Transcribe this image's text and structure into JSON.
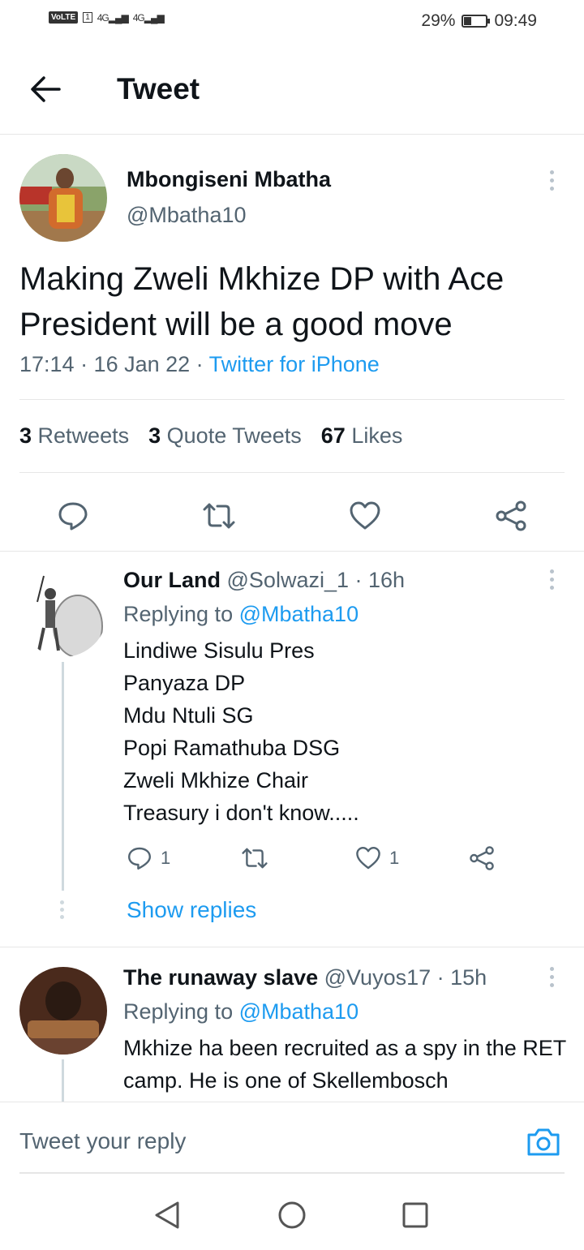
{
  "statusbar": {
    "volte": "VoLTE",
    "sim": "1",
    "net1": "4G",
    "net2": "4G",
    "battery_text": "29%",
    "battery_level": 0.29,
    "time": "09:49"
  },
  "header": {
    "title": "Tweet"
  },
  "tweet": {
    "author_name": "Mbongiseni Mbatha",
    "author_handle": "@Mbatha10",
    "text": "Making Zweli Mkhize DP with Ace President will be a good move",
    "time": "17:14 · 16 Jan 22 · ",
    "source": "Twitter for iPhone",
    "retweets_count": "3",
    "retweets_label": "Retweets",
    "quotes_count": "3",
    "quotes_label": "Quote Tweets",
    "likes_count": "67",
    "likes_label": "Likes"
  },
  "replies": [
    {
      "name": "Our Land",
      "meta": "@Solwazi_1 · 16h",
      "replying_prefix": "Replying to ",
      "replying_to": "@Mbatha10",
      "lines": [
        "Lindiwe Sisulu Pres",
        "Panyaza DP",
        "Mdu Ntuli SG",
        "Popi Ramathuba DSG",
        "Zweli Mkhize Chair",
        "Treasury i don't know....."
      ],
      "reply_count": "1",
      "like_count": "1",
      "show_replies": "Show replies"
    },
    {
      "name": "The runaway slave",
      "meta": "@Vuyos17 · 15h",
      "replying_prefix": "Replying to ",
      "replying_to": "@Mbatha10",
      "text": "Mkhize ha been recruited as a spy in the RET camp. He is one of Skellembosch"
    }
  ],
  "composer": {
    "placeholder": "Tweet your reply"
  },
  "icons": {
    "back": "arrow-left-icon",
    "reply": "speech-bubble-icon",
    "retweet": "retweet-icon",
    "like": "heart-icon",
    "share": "share-icon",
    "camera": "camera-icon"
  },
  "colors": {
    "accent": "#1d9bf0",
    "muted": "#536471",
    "text": "#0f1419"
  }
}
